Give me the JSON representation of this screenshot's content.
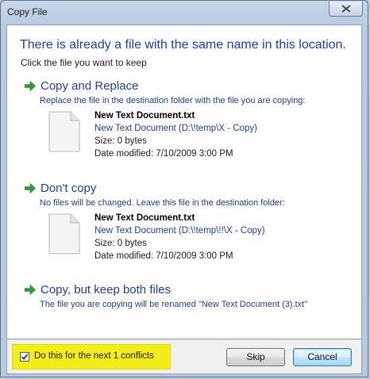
{
  "window": {
    "title": "Copy File",
    "close_icon": "close-icon"
  },
  "main": {
    "heading": "There is already a file with the same name in this location.",
    "subheading": "Click the file you want to keep",
    "options": [
      {
        "icon": "green-arrow-icon",
        "title": "Copy and Replace",
        "description": "Replace the file in the destination folder with the file you are copying:",
        "file": {
          "icon": "document-icon",
          "name": "New Text Document.txt",
          "path": "New Text Document (D:\\!temp\\X - Copy)",
          "size": "Size: 0 bytes",
          "modified": "Date modified: 7/10/2009 3:00 PM"
        }
      },
      {
        "icon": "green-arrow-icon",
        "title": "Don't copy",
        "description": "No files will be changed. Leave this file in the destination folder:",
        "file": {
          "icon": "document-icon",
          "name": "New Text Document.txt",
          "path": "New Text Document (D:\\!temp\\!!\\X - Copy)",
          "size": "Size: 0 bytes",
          "modified": "Date modified: 7/10/2009 3:00 PM"
        }
      },
      {
        "icon": "green-arrow-icon",
        "title": "Copy, but keep both files",
        "description": "The file you are copying will be renamed \"New Text Document (3).txt\""
      }
    ]
  },
  "footer": {
    "checkbox_label": "Do this for the next 1 conflicts",
    "checkbox_checked": true,
    "highlight_color": "#f3ee1a",
    "skip_label": "Skip",
    "cancel_label": "Cancel"
  },
  "colors": {
    "link_blue": "#1b3f9b",
    "arrow_green": "#2ea02e"
  }
}
